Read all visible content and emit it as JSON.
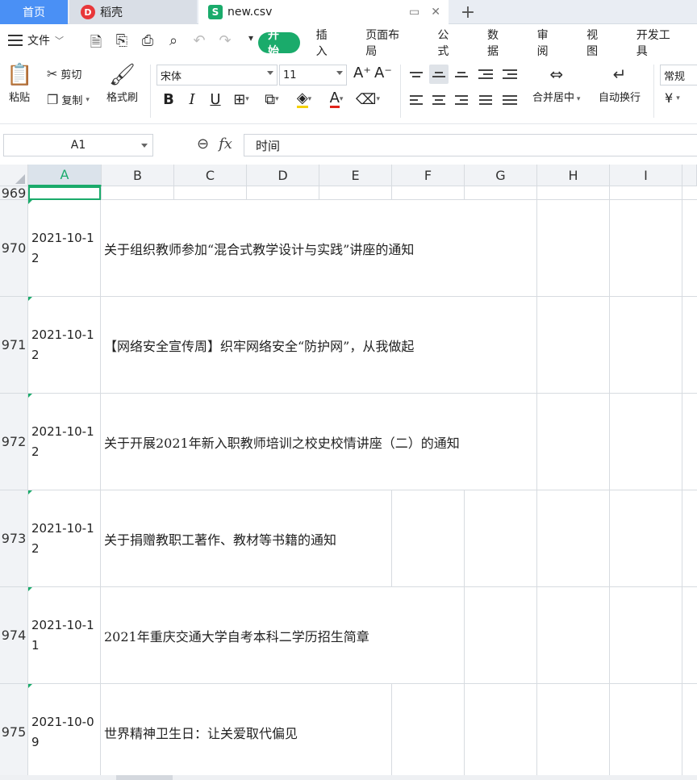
{
  "tabs": {
    "home": "首页",
    "daoke": "稻壳",
    "file": "new.csv"
  },
  "menu": {
    "file_label": "文件",
    "tabs": [
      "开始",
      "插入",
      "页面布局",
      "公式",
      "数据",
      "审阅",
      "视图",
      "开发工具"
    ],
    "active_tab": "开始"
  },
  "ribbon": {
    "paste": "粘贴",
    "cut": "剪切",
    "copy": "复制",
    "format_painter": "格式刷",
    "font_name": "宋体",
    "font_size": "11",
    "merge_center": "合并居中",
    "wrap_text": "自动换行",
    "number_format": "常规",
    "currency_symbol": "¥"
  },
  "formula_bar": {
    "cell_ref": "A1",
    "content": "时间"
  },
  "columns": [
    "A",
    "B",
    "C",
    "D",
    "E",
    "F",
    "G",
    "H",
    "I"
  ],
  "active_column": "A",
  "rows": [
    {
      "num": "969",
      "date": "",
      "title": ""
    },
    {
      "num": "970",
      "date": "2021-10-12",
      "title": "关于组织教师参加“混合式教学设计与实践”讲座的通知"
    },
    {
      "num": "971",
      "date": "2021-10-12",
      "title": "【网络安全宣传周】织牢网络安全“防护网”，从我做起"
    },
    {
      "num": "972",
      "date": "2021-10-12",
      "title": "关于开展2021年新入职教师培训之校史校情讲座（二）的通知"
    },
    {
      "num": "973",
      "date": "2021-10-12",
      "title": "关于捐赠教职工著作、教材等书籍的通知"
    },
    {
      "num": "974",
      "date": "2021-10-11",
      "title": "2021年重庆交通大学自考本科二学历招生简章"
    },
    {
      "num": "975",
      "date": "2021-10-09",
      "title": "世界精神卫生日：让关爱取代偏见"
    }
  ],
  "colors": {
    "accent": "#1aab6b",
    "home_tab": "#4a90f5"
  }
}
